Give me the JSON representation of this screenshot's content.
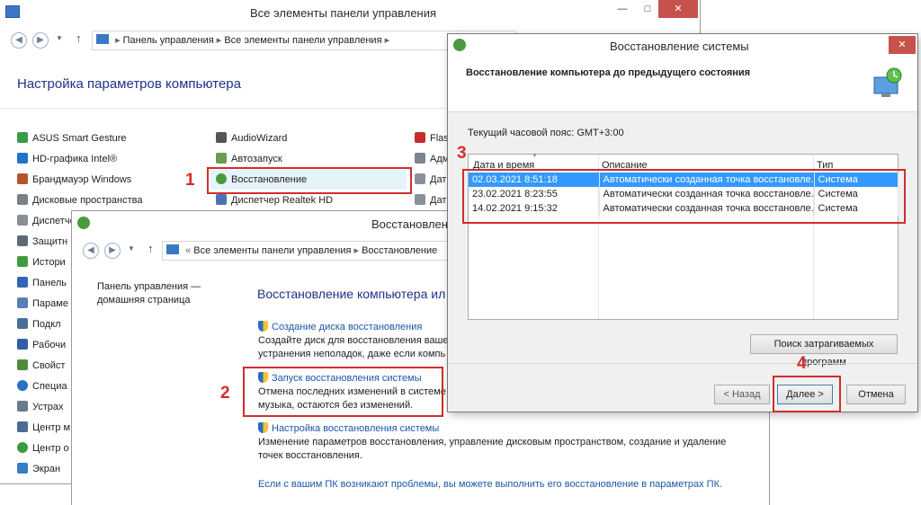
{
  "cp_window": {
    "title": "Все элементы панели управления",
    "breadcrumb": [
      "Панель управления",
      "Все элементы панели управления"
    ],
    "heading": "Настройка параметров компьютера",
    "col1": [
      "ASUS Smart Gesture",
      "HD-графика Intel®",
      "Брандмауэр Windows",
      "Дисковые пространства",
      "Диспетчер",
      "Защитн",
      "Истори",
      "Панель",
      "Парамe",
      "Подкл",
      "Рабочи",
      "Свойст",
      "Специа",
      "Устрах",
      "Центр м",
      "Центр о",
      "Экран"
    ],
    "col2": [
      "AudioWizard",
      "Автозапуск",
      "Восстановление",
      "Диспетчер Realtek HD"
    ],
    "col3": [
      "Flas",
      "Адм",
      "Дат",
      "Дат"
    ],
    "minimize": "—",
    "maximize": "□",
    "close": "✕"
  },
  "recovery_window": {
    "title": "Восстановление",
    "breadcrumb": [
      "Все элементы панели управления",
      "Восстановление"
    ],
    "sidebar_link_line1": "Панель управления —",
    "sidebar_link_line2": "домашняя страница",
    "heading": "Восстановление компьютера ил",
    "items": [
      {
        "title": "Создание диска восстановления",
        "desc1": "Создайте диск для восстановления вашег",
        "desc2": "устранения неполадок, даже если компь"
      },
      {
        "title": "Запуск восстановления системы",
        "desc1": "Отмена последних изменений в системе",
        "desc2": "музыка, остаются без изменений."
      },
      {
        "title": "Настройка восстановления системы",
        "desc1": "Изменение параметров восстановления, управление дисковым пространством, создание и удаление",
        "desc2": "точек восстановления."
      }
    ],
    "footer_link": "Если с вашим ПК возникают проблемы, вы можете выполнить его восстановление в параметрах ПК."
  },
  "sr_dialog": {
    "title": "Восстановление системы",
    "close": "✕",
    "header": "Восстановление компьютера до предыдущего состояния",
    "timezone": "Текущий часовой пояс: GMT+3:00",
    "columns": [
      "Дата и время",
      "Описание",
      "Тип"
    ],
    "rows": [
      {
        "date": "02.03.2021 8:51:18",
        "desc": "Автоматически созданная точка восстановле...",
        "type": "Система"
      },
      {
        "date": "23.02.2021 8:23:55",
        "desc": "Автоматически созданная точка восстановле...",
        "type": "Система"
      },
      {
        "date": "14.02.2021 9:15:32",
        "desc": "Автоматически созданная точка восстановле...",
        "type": "Система"
      }
    ],
    "scan_button": "Поиск затрагиваемых программ",
    "back_button": "< Назад",
    "next_button": "Далее >",
    "cancel_button": "Отмена"
  },
  "annotations": [
    "1",
    "2",
    "3",
    "4"
  ],
  "colors": {
    "accent_red": "#d22d2d",
    "link_blue": "#1a57a6",
    "selection": "#3399ff"
  }
}
